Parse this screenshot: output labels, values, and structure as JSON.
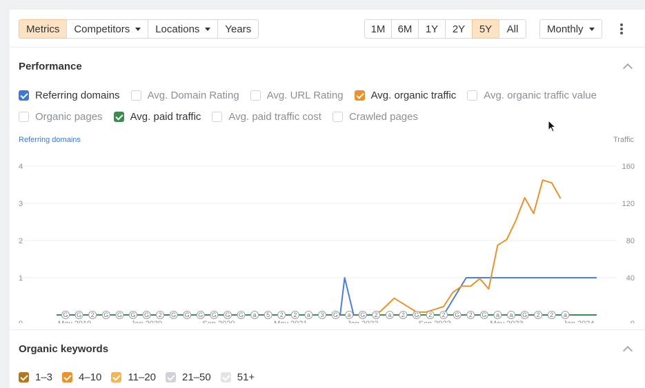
{
  "toolbar": {
    "tabs": [
      {
        "label": "Metrics",
        "active": true
      },
      {
        "label": "Competitors",
        "dropdown": true
      },
      {
        "label": "Locations",
        "dropdown": true
      },
      {
        "label": "Years",
        "dropdown": false
      }
    ],
    "ranges": [
      "1M",
      "6M",
      "1Y",
      "2Y",
      "5Y",
      "All"
    ],
    "active_range": "5Y",
    "interval": "Monthly"
  },
  "performance": {
    "title": "Performance",
    "metrics": [
      {
        "label": "Referring domains",
        "checked": true,
        "color": "#3b78d8"
      },
      {
        "label": "Avg. Domain Rating",
        "checked": false
      },
      {
        "label": "Avg. URL Rating",
        "checked": false
      },
      {
        "label": "Avg. organic traffic",
        "checked": true,
        "color": "#e8922b"
      },
      {
        "label": "Avg. organic traffic value",
        "checked": false
      },
      {
        "label": "Organic pages",
        "checked": false
      },
      {
        "label": "Avg. paid traffic",
        "checked": true,
        "color": "#3d8b4f"
      },
      {
        "label": "Avg. paid traffic cost",
        "checked": false
      },
      {
        "label": "Crawled pages",
        "checked": false
      }
    ]
  },
  "chart_data": {
    "type": "line",
    "left_axis_label": "Referring domains",
    "right_axis_label": "Traffic",
    "left_ylim": [
      0,
      4
    ],
    "right_ylim": [
      0,
      160
    ],
    "left_ticks": [
      "0",
      "1",
      "2",
      "3",
      "4"
    ],
    "right_ticks": [
      "0",
      "40",
      "80",
      "120",
      "160"
    ],
    "x_ticks": [
      "May 2019",
      "Jan 2020",
      "Sep 2020",
      "May 2021",
      "Jan 2022",
      "Sep 2022",
      "May 2023",
      "Jan 2024"
    ],
    "grid": true,
    "series": [
      {
        "name": "Referring domains",
        "axis": "left",
        "color": "#4a7fd1",
        "points": [
          [
            0,
            0
          ],
          [
            31.5,
            0
          ],
          [
            32,
            1
          ],
          [
            33,
            0
          ],
          [
            43,
            0
          ],
          [
            45.5,
            1
          ],
          [
            47,
            1
          ],
          [
            60,
            1
          ]
        ]
      },
      {
        "name": "Avg. organic traffic",
        "axis": "right",
        "color": "#e8922b",
        "points": [
          [
            35,
            0
          ],
          [
            36,
            4
          ],
          [
            37.5,
            18
          ],
          [
            39,
            9
          ],
          [
            40,
            3
          ],
          [
            41,
            3
          ],
          [
            42,
            6
          ],
          [
            43,
            9
          ],
          [
            44,
            24
          ],
          [
            45,
            31
          ],
          [
            46,
            31
          ],
          [
            47,
            39
          ],
          [
            48,
            28
          ],
          [
            49,
            75
          ],
          [
            50,
            81
          ],
          [
            51,
            101
          ],
          [
            52,
            126
          ],
          [
            53,
            109
          ],
          [
            54,
            145
          ],
          [
            55,
            142
          ],
          [
            56,
            125
          ]
        ]
      },
      {
        "name": "Avg. paid traffic",
        "axis": "right",
        "color": "#3d8b4f",
        "points": [
          [
            0,
            0
          ],
          [
            60,
            0
          ]
        ]
      }
    ],
    "annotations": [
      "G",
      "G",
      "2",
      "G",
      "G",
      "G",
      "G",
      "2",
      "G",
      "G",
      "G",
      "G",
      "G",
      "G",
      "a",
      "5",
      "2",
      "2",
      "a",
      "3",
      "G",
      "a",
      "G",
      "2",
      "a",
      "2",
      "G",
      "2",
      "2",
      "G",
      "2",
      "G",
      "a",
      "a",
      "G",
      "2",
      "2",
      "a"
    ]
  },
  "organic_keywords": {
    "title": "Organic keywords",
    "ranges": [
      {
        "label": "1–3",
        "checked": true,
        "color": "#b5761f"
      },
      {
        "label": "4–10",
        "checked": true,
        "color": "#e8922b"
      },
      {
        "label": "11–20",
        "checked": true,
        "color": "#f2b55a"
      },
      {
        "label": "21–50",
        "checked": true,
        "color": "#cfd3d8"
      },
      {
        "label": "51+",
        "checked": true,
        "color": "#e2e5e8"
      }
    ]
  }
}
